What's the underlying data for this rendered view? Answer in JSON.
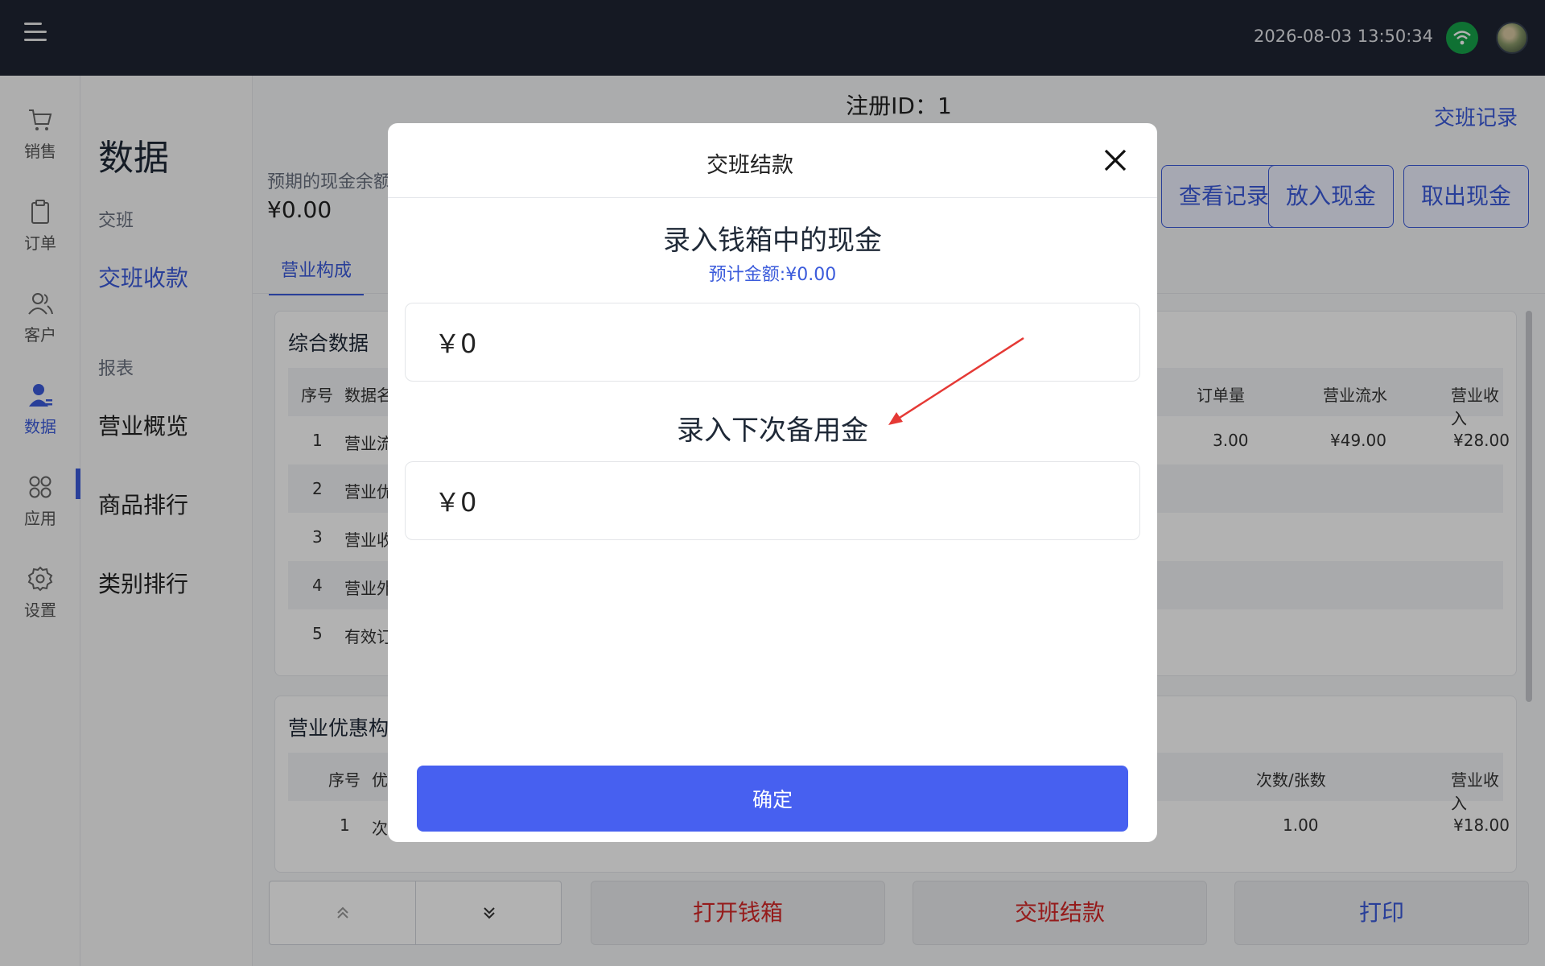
{
  "topbar": {
    "datetime": "2026-08-03 13:50:34"
  },
  "rail": {
    "items": [
      {
        "label": "销售",
        "icon": "cart-icon"
      },
      {
        "label": "订单",
        "icon": "clipboard-icon"
      },
      {
        "label": "客户",
        "icon": "users-icon"
      },
      {
        "label": "数据",
        "icon": "user-data-icon"
      },
      {
        "label": "应用",
        "icon": "apps-icon"
      },
      {
        "label": "设置",
        "icon": "gear-icon"
      }
    ],
    "active_index": 3
  },
  "subnav": {
    "title": "数据",
    "group_shift": "交班",
    "item_shift_payment": "交班收款",
    "group_report": "报表",
    "item_overview": "营业概览",
    "item_product_rank": "商品排行",
    "item_category_rank": "类别排行"
  },
  "main": {
    "register_id": "注册ID：1",
    "handover_record": "交班记录",
    "expected_cash_label": "预期的现金余额",
    "expected_cash_value": "¥0.00",
    "buttons": {
      "view_record": "查看记录",
      "put_cash": "放入现金",
      "take_cash": "取出现金"
    },
    "tab_business": "营业构成",
    "card1": {
      "title": "综合数据",
      "headers_left": [
        "序号",
        "数据名"
      ],
      "headers_right": [
        "订单量",
        "营业流水",
        "营业收入"
      ],
      "rows": [
        {
          "no": "1",
          "name": "营业流",
          "orders": "3.00",
          "flow": "¥49.00",
          "income": "¥28.00"
        },
        {
          "no": "2",
          "name": "营业优"
        },
        {
          "no": "3",
          "name": "营业收"
        },
        {
          "no": "4",
          "name": "营业外"
        },
        {
          "no": "5",
          "name": "有效订"
        }
      ]
    },
    "card2": {
      "title": "营业优惠构",
      "headers_left": [
        "序号",
        "优"
      ],
      "headers_right": [
        "次数/张数",
        "营业收入"
      ],
      "rows": [
        {
          "no": "1",
          "name": "次",
          "count": "1.00",
          "income": "¥18.00"
        }
      ]
    }
  },
  "footer": {
    "open_drawer": "打开钱箱",
    "shift_settle": "交班结款",
    "print": "打印"
  },
  "modal": {
    "title": "交班结款",
    "cash_heading": "录入钱箱中的现金",
    "estimated": "预计金额:¥0.00",
    "cash_value": "￥0",
    "reserve_heading": "录入下次备用金",
    "reserve_value": "￥0",
    "confirm": "确定"
  },
  "colors": {
    "accent": "#4760f0",
    "link": "#3b5bdb",
    "danger": "#d62828",
    "topbar": "#1f2533",
    "annotation_arrow": "#e53935"
  }
}
